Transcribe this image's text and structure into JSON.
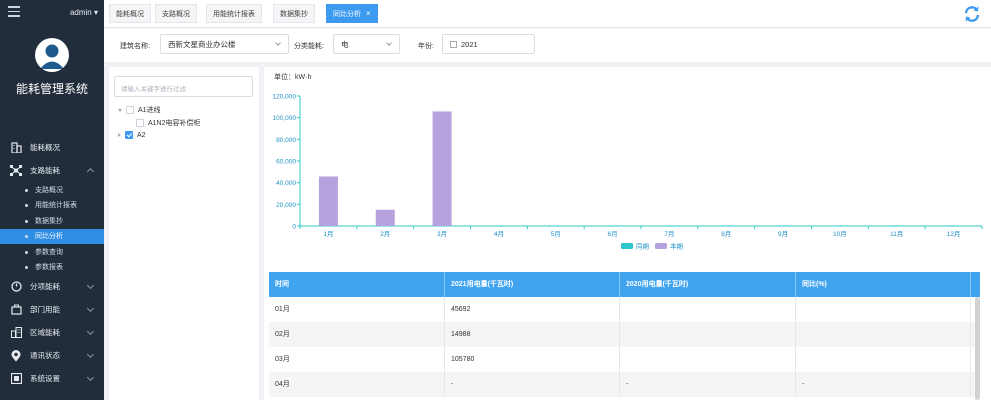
{
  "header": {
    "user": "admin",
    "user_arrow": "▾"
  },
  "sidebar": {
    "title": "能耗管理系统",
    "items": [
      {
        "label": "能耗概况",
        "icon": "building-icon"
      },
      {
        "label": "支路能耗",
        "icon": "network-icon",
        "expanded": true,
        "children": [
          {
            "label": "支路概况"
          },
          {
            "label": "用能统计报表"
          },
          {
            "label": "数据集抄"
          },
          {
            "label": "同比分析",
            "active": true
          },
          {
            "label": "参数查询"
          },
          {
            "label": "参数报表"
          }
        ]
      },
      {
        "label": "分项能耗",
        "icon": "gauge-icon"
      },
      {
        "label": "部门用能",
        "icon": "department-icon"
      },
      {
        "label": "区域能耗",
        "icon": "region-icon"
      },
      {
        "label": "通讯状态",
        "icon": "location-icon"
      },
      {
        "label": "系统设置",
        "icon": "settings-icon"
      }
    ]
  },
  "tabs": [
    {
      "label": "能耗概况"
    },
    {
      "label": "支路概况"
    },
    {
      "label": "用能统计报表"
    },
    {
      "label": "数据集抄"
    },
    {
      "label": "同比分析",
      "active": true,
      "close": "×"
    }
  ],
  "filters": {
    "building_label": "建筑名称:",
    "building_value": "西新文星商业办公楼",
    "category_label": "分类能耗:",
    "category_value": "电",
    "year_label": "年份:",
    "year_value": "2021"
  },
  "tree": {
    "search_placeholder": "请输入关键字进行过滤",
    "nodes": [
      {
        "label": "A1进线",
        "checked": false
      },
      {
        "label": "A1N2电容补偿柜",
        "checked": false
      },
      {
        "label": "A2",
        "checked": true
      }
    ]
  },
  "chart_data": {
    "type": "bar",
    "unit_label": "单位：kW·h",
    "categories": [
      "1月",
      "2月",
      "3月",
      "4月",
      "5月",
      "6月",
      "7月",
      "8月",
      "9月",
      "10月",
      "11月",
      "12月"
    ],
    "series": [
      {
        "name": "同期",
        "color": "#2ec7c9",
        "values": [
          0,
          0,
          0,
          0,
          0,
          0,
          0,
          0,
          0,
          0,
          0,
          0
        ]
      },
      {
        "name": "本期",
        "color": "#b6a2de",
        "values": [
          45692,
          14988,
          105780,
          0,
          0,
          0,
          0,
          0,
          0,
          0,
          0,
          0
        ]
      }
    ],
    "ylim": [
      0,
      120000
    ],
    "yticks": [
      "0",
      "20,000",
      "40,000",
      "60,000",
      "80,000",
      "100,000",
      "120,000"
    ],
    "legend_position": "bottom-center",
    "axis_color": "#2ec7c9",
    "tick_label_color": "#1e90c8"
  },
  "table": {
    "headers": [
      "时间",
      "2021用电量(千瓦时)",
      "2020用电量(千瓦时)",
      "同比(%)"
    ],
    "rows": [
      [
        "01月",
        "45692",
        "",
        ""
      ],
      [
        "02月",
        "14988",
        "",
        ""
      ],
      [
        "03月",
        "105780",
        "",
        ""
      ],
      [
        "04月",
        "-",
        "-",
        "-"
      ]
    ]
  },
  "colors": {
    "sidebar_bg": "#222d3c",
    "accent": "#3c9bf0",
    "table_header": "#3fa3ef"
  }
}
